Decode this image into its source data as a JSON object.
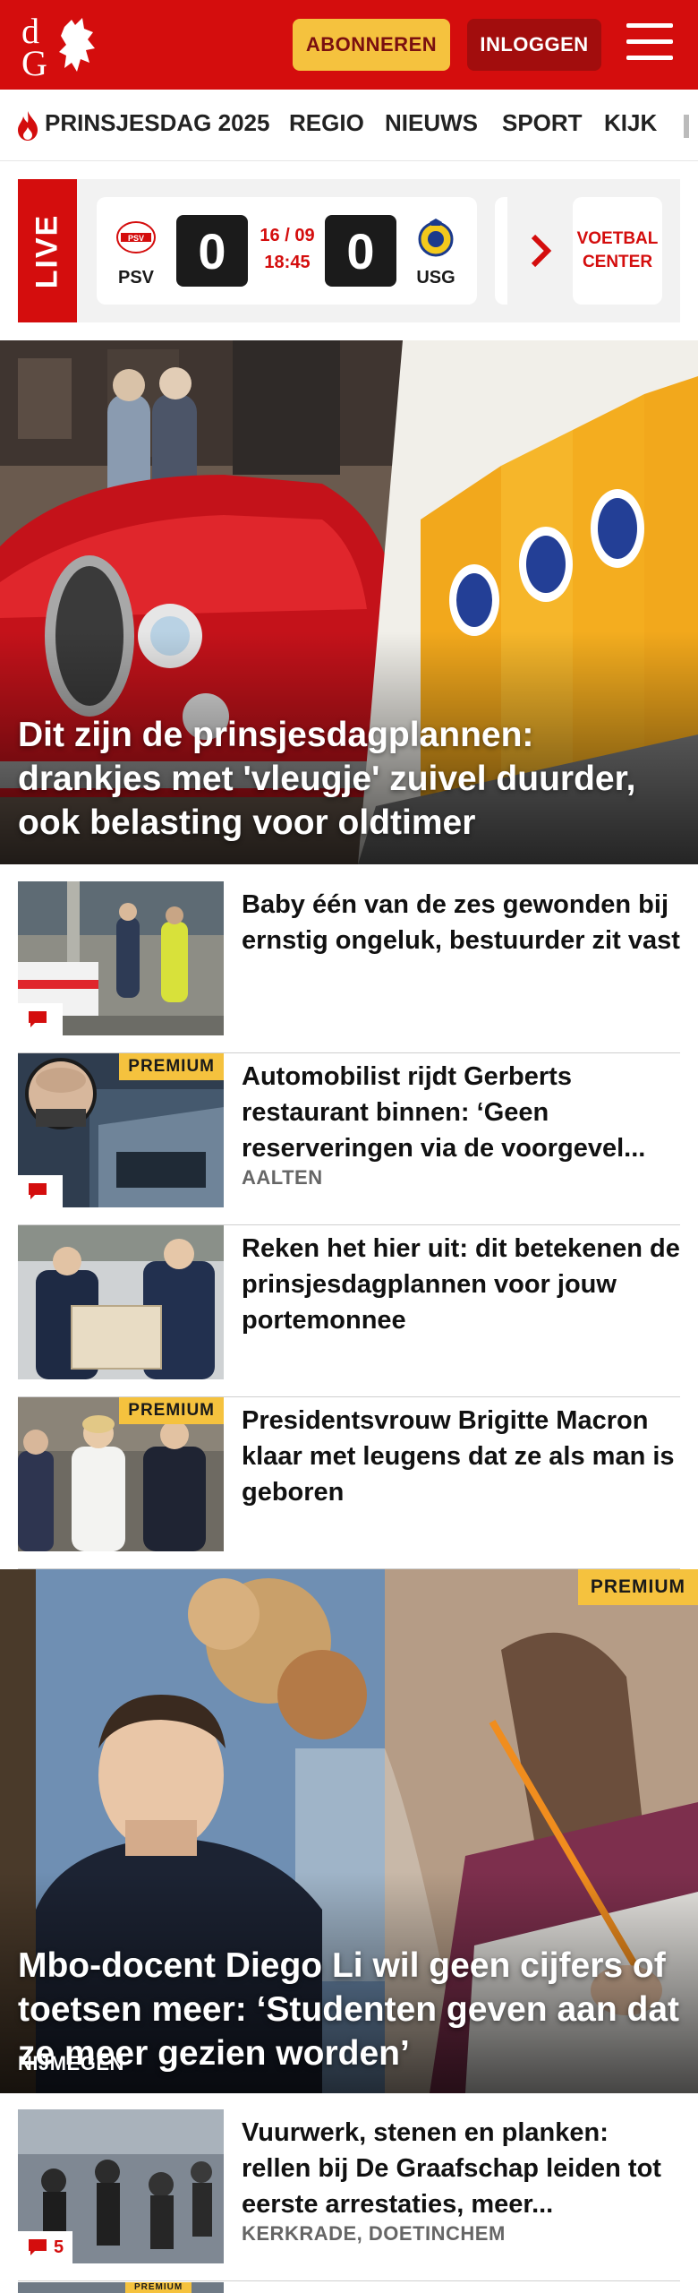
{
  "header": {
    "subscribe_label": "ABONNEREN",
    "login_label": "INLOGGEN",
    "brand_color": "#d40d0d",
    "accent_color": "#f5c23e"
  },
  "nav": {
    "items": [
      {
        "label": "PRINSJESDAG 2025",
        "icon": "flame-icon"
      },
      {
        "label": "REGIO"
      },
      {
        "label": "NIEUWS"
      },
      {
        "label": "SPORT"
      },
      {
        "label": "KIJK"
      }
    ]
  },
  "live": {
    "tag": "LIVE",
    "match": {
      "home_team": "PSV",
      "away_team": "USG",
      "home_score": "0",
      "away_score": "0",
      "date": "16 / 09",
      "time": "18:45"
    },
    "football_center_line1": "VOETBAL",
    "football_center_line2": "CENTER"
  },
  "hero": {
    "title": "Dit zijn de prinsjesdagplannen: drankjes met 'vleugje' zuivel duurder, ook belasting voor oldtimer"
  },
  "articles": [
    {
      "title": "Baby één van de zes gewonden bij ernstig ongeluk, bestuurder zit vast",
      "location": "",
      "premium": false,
      "comments": ""
    },
    {
      "title": "Automobilist rijdt Gerberts restaurant binnen: ‘Geen reserveringen via de voorgevel...",
      "location": "AALTEN",
      "premium": true,
      "premium_label": "PREMIUM",
      "comments": ""
    },
    {
      "title": "Reken het hier uit: dit betekenen de prinsjesdagplannen voor jouw portemonnee",
      "location": "",
      "premium": false,
      "comments": ""
    },
    {
      "title": "Presidentsvrouw Brigitte Macron klaar met leugens dat ze als man is geboren",
      "location": "",
      "premium": true,
      "premium_label": "PREMIUM",
      "comments": ""
    }
  ],
  "feature": {
    "premium_label": "PREMIUM",
    "title": "Mbo-docent Diego Li wil geen cijfers of toetsen meer: ‘Studenten geven aan dat ze meer gezien worden’",
    "location": "NIJMEGEN"
  },
  "article_bottom": {
    "title": "Vuurwerk, stenen en planken: rellen bij De Graafschap leiden tot eerste arrestaties, meer...",
    "location": "KERKRADE, DOETINCHEM",
    "comments": "5",
    "next_premium_label": "PREMIUM"
  }
}
